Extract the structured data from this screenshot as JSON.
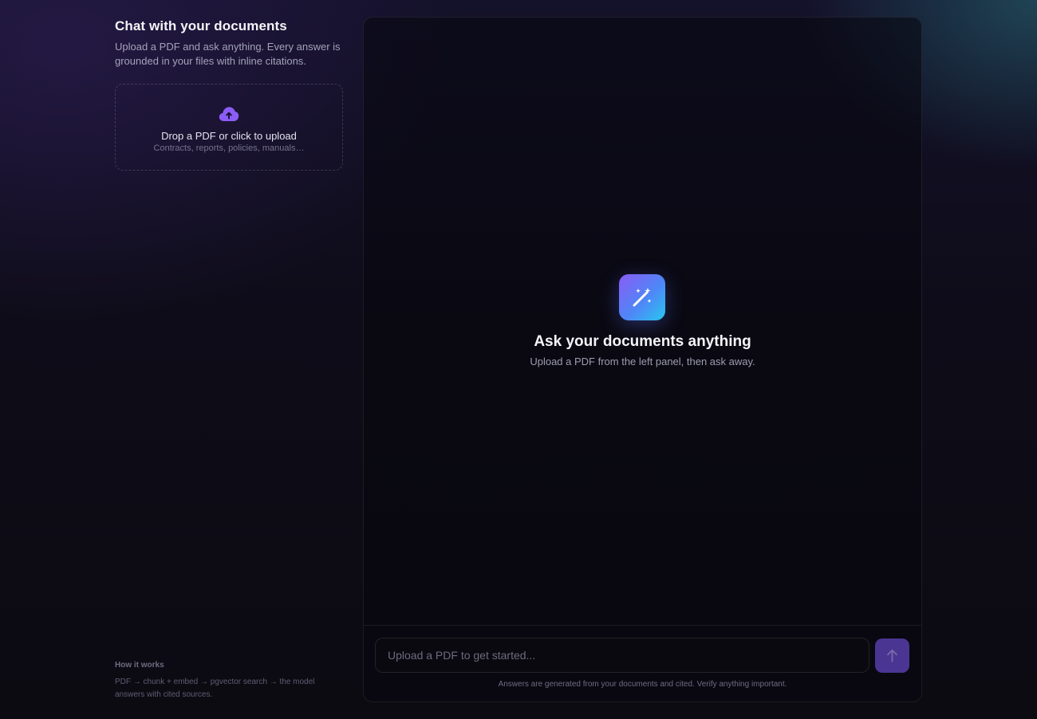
{
  "sidebar": {
    "title": "Chat with your documents",
    "subtitle": "Upload a PDF and ask anything. Every answer is grounded in your files with inline citations.",
    "dropzone": {
      "icon": "cloud-upload-icon",
      "title": "Drop a PDF or click to upload",
      "hint": "Contracts, reports, policies, manuals…"
    },
    "how_it_works": {
      "title": "How it works",
      "text": "PDF → chunk + embed → pgvector search → the model answers with cited sources."
    }
  },
  "chat": {
    "empty_state": {
      "icon": "magic-wand-icon",
      "title": "Ask your documents anything",
      "subtitle": "Upload a PDF from the left panel, then ask away."
    },
    "composer": {
      "placeholder": "Upload a PDF to get started...",
      "send_icon": "arrow-up-icon",
      "disclaimer": "Answers are generated from your documents and cited. Verify anything important."
    }
  },
  "colors": {
    "accent": "#8b5cf6",
    "accent_gradient_start": "#8a5cf5",
    "accent_gradient_end": "#28c7f0",
    "send_button": "#4a3593",
    "background": "#0d0c14"
  }
}
